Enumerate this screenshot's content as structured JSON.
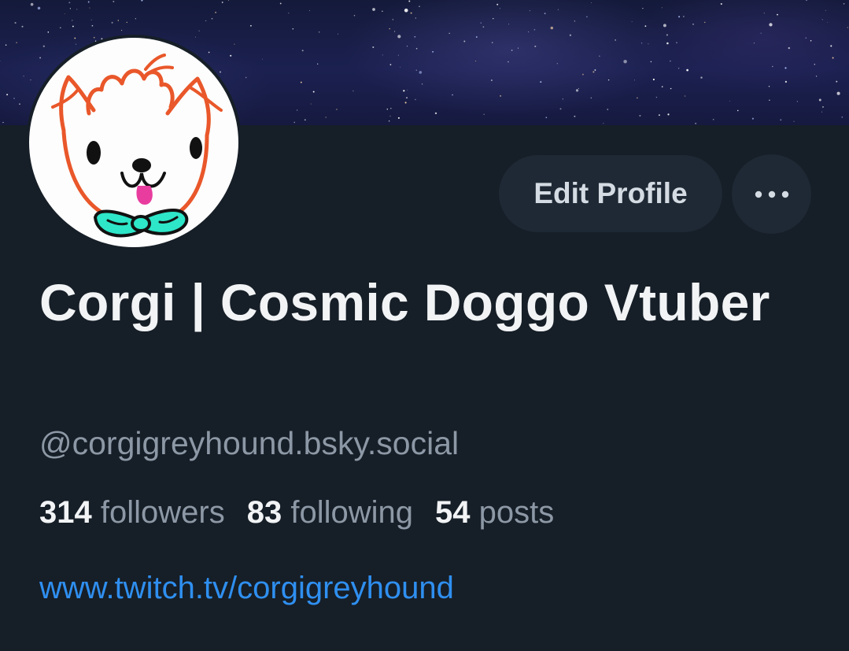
{
  "profile": {
    "display_name": "Corgi | Cosmic Doggo Vtuber",
    "handle": "@corgigreyhound.bsky.social",
    "link": "www.twitch.tv/corgigreyhound",
    "avatar_icon": "corgi-drawing-avatar",
    "banner": "starry-night-sky"
  },
  "actions": {
    "edit_profile_label": "Edit Profile",
    "more_icon": "ellipsis-icon"
  },
  "stats": {
    "followers_count": "314",
    "followers_label": "followers",
    "following_count": "83",
    "following_label": "following",
    "posts_count": "54",
    "posts_label": "posts"
  },
  "colors": {
    "background": "#161e27",
    "button_background": "#1e2935",
    "text_primary": "#f1f3f5",
    "text_secondary": "#8d98a6",
    "link": "#2f8ff0"
  }
}
